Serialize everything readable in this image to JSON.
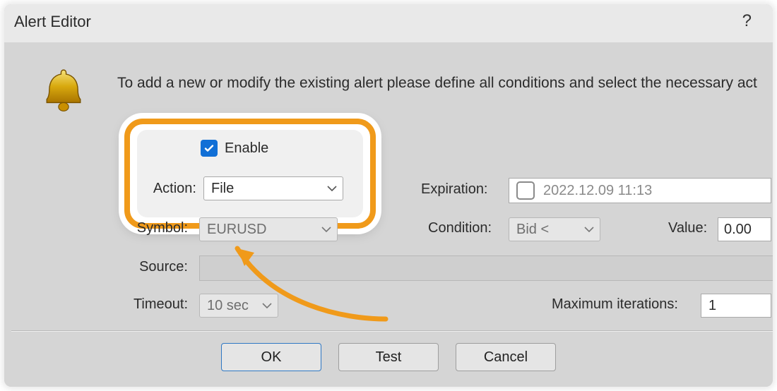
{
  "window": {
    "title": "Alert Editor",
    "help_glyph": "?"
  },
  "intro_text": "To add a new or modify the existing alert please define all conditions and select the necessary act",
  "enable": {
    "label": "Enable",
    "checked": true
  },
  "labels": {
    "action": "Action:",
    "symbol": "Symbol:",
    "source": "Source:",
    "timeout": "Timeout:",
    "expiration": "Expiration:",
    "condition": "Condition:",
    "value": "Value:",
    "max_iterations": "Maximum iterations:"
  },
  "fields": {
    "action": "File",
    "symbol": "EURUSD",
    "timeout": "10 sec",
    "expiration_enabled": false,
    "expiration": "2022.12.09 11:13",
    "condition": "Bid <",
    "value": "0.00",
    "max_iterations": "1",
    "source": ""
  },
  "buttons": {
    "ok": "OK",
    "test": "Test",
    "cancel": "Cancel"
  },
  "icons": {
    "bell": "bell-icon"
  },
  "colors": {
    "highlight_border": "#f09a1a",
    "checkbox_bg": "#116fd6"
  }
}
